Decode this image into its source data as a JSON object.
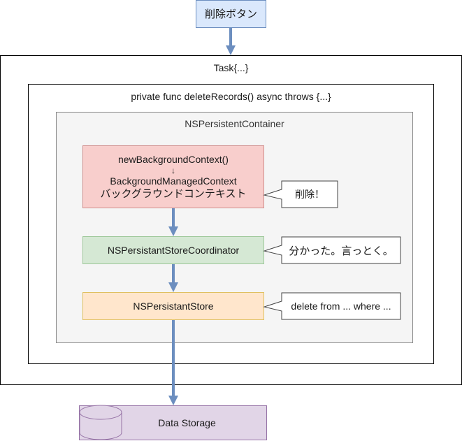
{
  "diagram": {
    "trigger": {
      "label": "削除ボタン"
    },
    "task_frame": {
      "label": "Task{...}"
    },
    "func_frame": {
      "label": "private func deleteRecords() async throws {...}"
    },
    "container_frame": {
      "label": "NSPersistentContainer"
    },
    "context_node": {
      "line1": "newBackgroundContext()",
      "arrow": "↓",
      "line2": "BackgroundManagedContext",
      "line3": "バックグラウンドコンテキスト"
    },
    "coordinator_node": {
      "label": "NSPersistantStoreCoordinator"
    },
    "store_node": {
      "label": "NSPersistantStore"
    },
    "storage_node": {
      "label": "Data Storage",
      "icon": "database-cylinder-icon"
    },
    "callouts": [
      {
        "text": "削除！"
      },
      {
        "text": "分かった。言っとく。"
      },
      {
        "text": "delete from ... where ..."
      }
    ],
    "colors": {
      "arrow": "#6c8ebf",
      "trigger_fill": "#dae8fc",
      "context_fill": "#f8cecc",
      "context_stroke": "#d08f8d",
      "coordinator_fill": "#d5e8d4",
      "coordinator_stroke": "#9ec89a",
      "store_fill": "#ffe6cc",
      "store_stroke": "#e0c060",
      "storage_fill": "#e1d5e7",
      "storage_stroke": "#9673a6",
      "container_fill": "#f5f5f5"
    }
  }
}
